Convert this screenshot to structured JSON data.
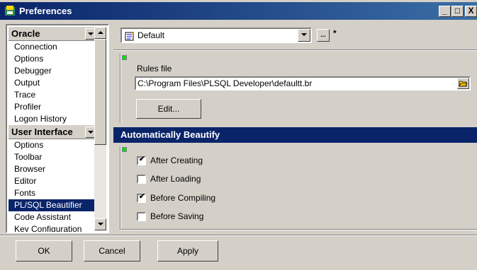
{
  "window": {
    "title": "Preferences"
  },
  "title_buttons": {
    "minimize": "_",
    "maximize": "□",
    "close": "X"
  },
  "sidebar": {
    "groups": [
      {
        "label": "Oracle",
        "items": [
          "Connection",
          "Options",
          "Debugger",
          "Output",
          "Trace",
          "Profiler",
          "Logon History"
        ]
      },
      {
        "label": "User Interface",
        "items": [
          "Options",
          "Toolbar",
          "Browser",
          "Editor",
          "Fonts",
          "PL/SQL Beautifier",
          "Code Assistant",
          "Key Configuration"
        ]
      }
    ],
    "selected": "PL/SQL Beautifier"
  },
  "profile": {
    "value": "Default",
    "ellipsis": "...",
    "modified_marker": "*"
  },
  "rules": {
    "label": "Rules file",
    "path": "C:\\Program Files\\PLSQL Developer\\defaultt.br",
    "edit_button": "Edit..."
  },
  "auto_beautify": {
    "header": "Automatically Beautify",
    "options": [
      {
        "label": "After Creating",
        "checked": true
      },
      {
        "label": "After Loading",
        "checked": false
      },
      {
        "label": "Before Compiling",
        "checked": true
      },
      {
        "label": "Before Saving",
        "checked": false
      }
    ]
  },
  "footer": {
    "ok": "OK",
    "cancel": "Cancel",
    "apply": "Apply"
  },
  "colors": {
    "title_bar": "#0a246a",
    "selection": "#0a246a",
    "face": "#d4d0c8",
    "indicator": "#00e000"
  }
}
